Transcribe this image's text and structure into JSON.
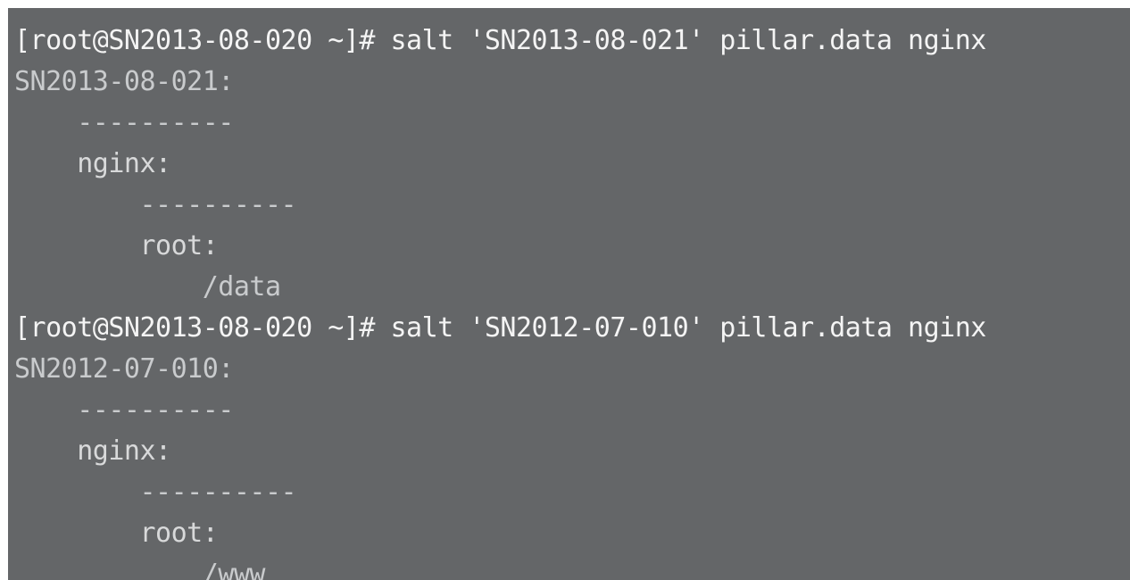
{
  "terminal": {
    "lines": [
      {
        "type": "command",
        "text": "[root@SN2013-08-020 ~]# salt 'SN2013-08-021' pillar.data nginx"
      },
      {
        "type": "output",
        "text": "SN2013-08-021:"
      },
      {
        "type": "output",
        "text": "    ----------"
      },
      {
        "type": "output",
        "text": "    nginx:"
      },
      {
        "type": "output",
        "text": "        ----------"
      },
      {
        "type": "output",
        "text": "        root:"
      },
      {
        "type": "output",
        "text": "            /data"
      },
      {
        "type": "command",
        "text": "[root@SN2013-08-020 ~]# salt 'SN2012-07-010' pillar.data nginx"
      },
      {
        "type": "output",
        "text": "SN2012-07-010:"
      },
      {
        "type": "output",
        "text": "    ----------"
      },
      {
        "type": "output",
        "text": "    nginx:"
      },
      {
        "type": "output",
        "text": "        ----------"
      },
      {
        "type": "output",
        "text": "        root:"
      },
      {
        "type": "output",
        "text": "            /www"
      }
    ]
  }
}
